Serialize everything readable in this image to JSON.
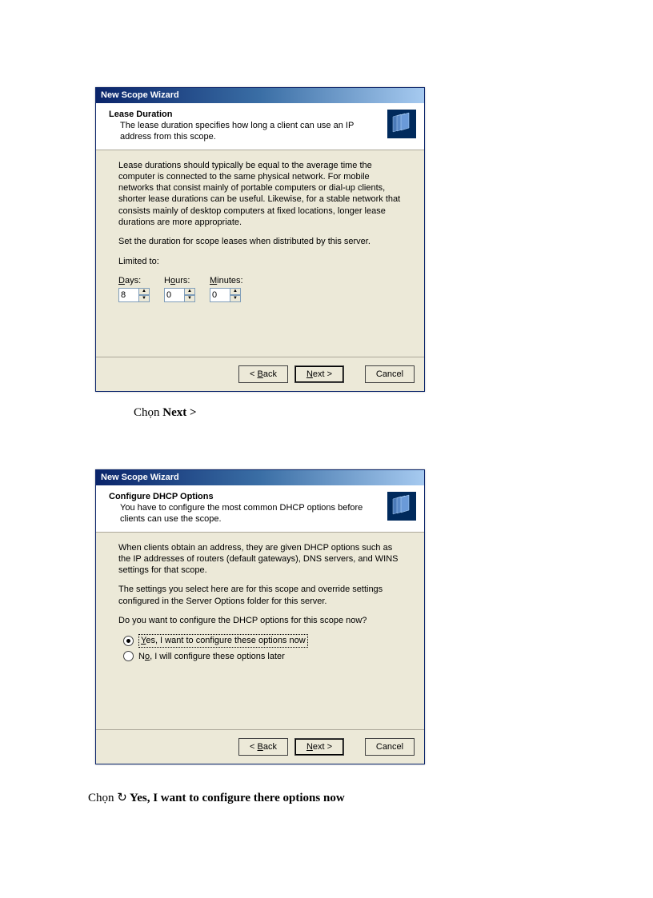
{
  "dialog1": {
    "title": "New Scope Wizard",
    "header_title": "Lease Duration",
    "header_desc": "The lease duration specifies how long a client can use an IP address from this scope.",
    "body_p1": "Lease durations should typically be equal to the average time the computer is connected to the same physical network. For mobile networks that consist mainly of portable computers or dial-up clients, shorter lease durations can be useful. Likewise, for a stable network that consists mainly of desktop computers at fixed locations, longer lease durations are more appropriate.",
    "body_p2": "Set the duration for scope leases when distributed by this server.",
    "limited_to": "Limited to:",
    "days_label": "Days:",
    "hours_label": "Hours:",
    "minutes_label": "Minutes:",
    "days_value": "8",
    "hours_value": "0",
    "minutes_value": "0",
    "back": "< Back",
    "next": "Next >",
    "cancel": "Cancel"
  },
  "dialog2": {
    "title": "New Scope Wizard",
    "header_title": "Configure DHCP Options",
    "header_desc": "You have to configure the most common DHCP options before clients can use the scope.",
    "body_p1": "When clients obtain an address, they are given DHCP options such as the IP addresses of routers (default gateways), DNS servers, and WINS settings for that scope.",
    "body_p2": "The settings you select here are for this scope and override settings configured in the Server Options folder for this server.",
    "body_p3": "Do you want to configure the DHCP options for this scope now?",
    "radio_yes": "Yes, I want to configure these options now",
    "radio_no": "No, I will configure these options later",
    "back": "< Back",
    "next": "Next >",
    "cancel": "Cancel"
  },
  "caption1_prefix": "Chọn ",
  "caption1_bold": "Next >",
  "caption2_prefix": "Chọn ",
  "caption2_symbol": "↻",
  "caption2_bold": " Yes, I want to configure there options now"
}
